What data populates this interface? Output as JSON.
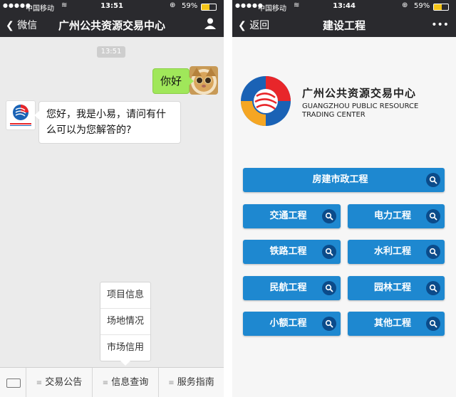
{
  "left_screen": {
    "status_bar": {
      "signal": "●●●●●",
      "carrier": "中国移动",
      "time": "13:51",
      "battery": "59%"
    },
    "nav": {
      "back_label": "微信",
      "title": "广州公共资源交易中心"
    },
    "chat": {
      "timestamp": "13:51",
      "user_message": "你好",
      "bot_message": "您好，我是小易，请问有什么可以为您解答的?"
    },
    "popup_menu": {
      "items": [
        "项目信息",
        "场地情况",
        "市场信用"
      ]
    },
    "bottom_menu": {
      "items": [
        "交易公告",
        "信息查询",
        "服务指南"
      ]
    }
  },
  "right_screen": {
    "status_bar": {
      "signal": "●●●●●",
      "carrier": "中国移动",
      "time": "13:44",
      "battery": "59%"
    },
    "nav": {
      "back_label": "返回",
      "title": "建设工程",
      "more": "•••"
    },
    "logo": {
      "cn": "广州公共资源交易中心",
      "en_line1": "GUANGZHOU PUBLIC RESOURCE",
      "en_line2": "TRADING CENTER"
    },
    "buttons": {
      "full": "房建市政工程",
      "grid": [
        "交通工程",
        "电力工程",
        "铁路工程",
        "水利工程",
        "民航工程",
        "园林工程",
        "小额工程",
        "其他工程"
      ]
    }
  },
  "colors": {
    "nav_bg": "#2a2a2e",
    "button_blue": "#1e88d0",
    "bubble_green": "#a0e75a",
    "logo_red": "#e8262a",
    "logo_blue": "#1a62b5"
  }
}
